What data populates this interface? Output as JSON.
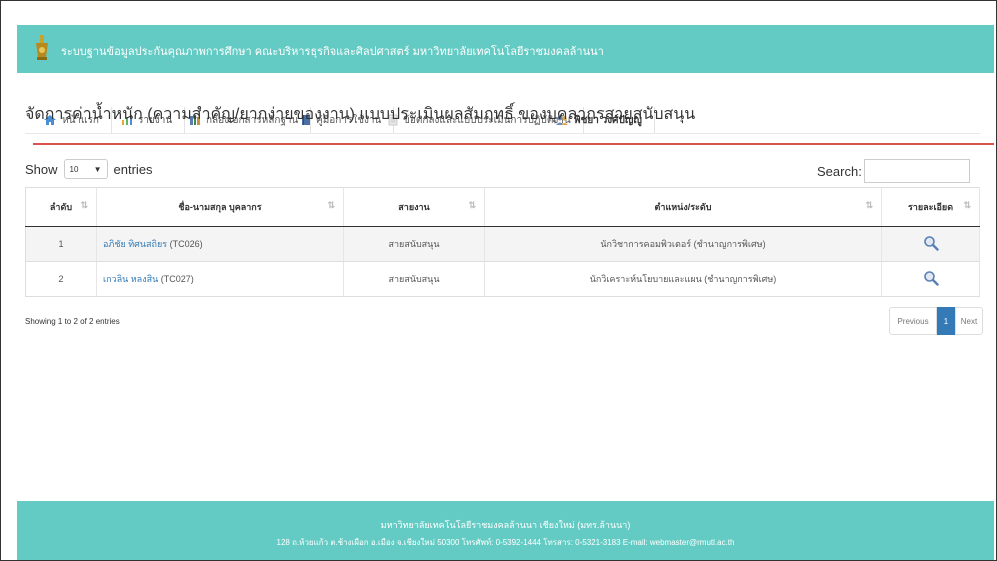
{
  "header": {
    "title": "ระบบฐานข้อมูลประกันคุณภาพการศึกษา คณะบริหารธุรกิจและศิลปศาสตร์ มหาวิทยาลัยเทคโนโลยีราชมงคลล้านนา"
  },
  "nav": {
    "items": [
      {
        "label": "หน้าแรก",
        "icon": "home-icon"
      },
      {
        "label": "รายงาน",
        "icon": "report-icon"
      },
      {
        "label": "กล่องเอกสารหลักฐาน",
        "icon": "books-icon"
      },
      {
        "label": "คู่มือการใช้งาน",
        "icon": "manual-icon"
      },
      {
        "label": "ข้อตกลงและแบบประเมินการปฏิบัติงาน",
        "icon": "document-icon"
      },
      {
        "label": "พิชยา วงศ์ปัญญู",
        "icon": "users-icon"
      }
    ]
  },
  "page": {
    "title": "จัดการค่าน้ำหนัก (ความสำคัญ/ยากง่ายของงาน) แบบประเมินผลสัมฤทธิ์ ของบุคลากรสายสนับสนุน"
  },
  "controls": {
    "show_label": "Show",
    "entries_value": "10",
    "entries_label": "entries",
    "search_label": "Search:"
  },
  "table": {
    "headers": [
      "ลำดับ",
      "ชื่อ-นามสกุล บุคลากร",
      "สายงาน",
      "ตำแหน่ง/ระดับ",
      "รายละเอียด"
    ],
    "rows": [
      {
        "no": "1",
        "name": "อภิชัย ทิศนสถิยร",
        "code": "(TC026)",
        "line": "สายสนับสนุน",
        "position": "นักวิชาการคอมพิวเตอร์ (ชำนาญการพิเศษ)"
      },
      {
        "no": "2",
        "name": "เกวลิน หลงสิน",
        "code": "(TC027)",
        "line": "สายสนับสนุน",
        "position": "นักวิเคราะห์นโยบายและแผน (ชำนาญการพิเศษ)"
      }
    ]
  },
  "info": "Showing 1 to 2 of 2 entries",
  "pager": {
    "previous": "Previous",
    "current": "1",
    "next": "Next"
  },
  "footer": {
    "line1": "มหาวิทยาลัยเทคโนโลยีราชมงคลล้านนา เชียงใหม่ (มทร.ล้านนา)",
    "line2": "128 ถ.ห้วยแก้ว ต.ช้างเผือก อ.เมือง จ.เชียงใหม่ 50300 โทรศัพท์: 0-5392-1444 โทรสาร: 0-5321-3183 E-mail: webmaster@rmutl.ac.th"
  },
  "colors": {
    "teal": "#63cbc3",
    "accent_red": "#d9534f",
    "link": "#337ab7"
  }
}
